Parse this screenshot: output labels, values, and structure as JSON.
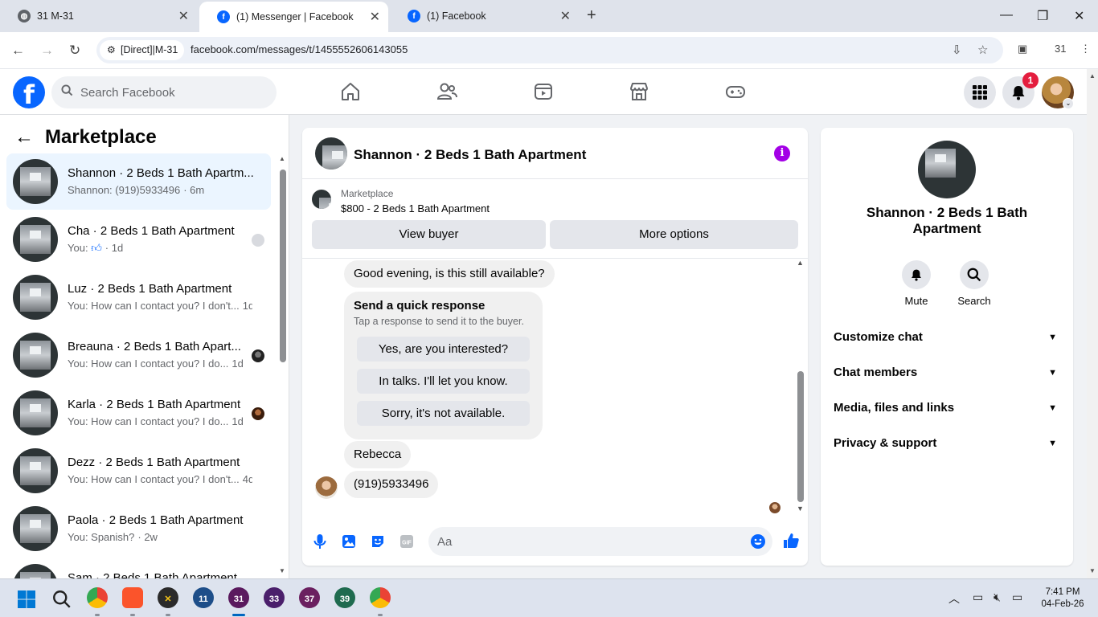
{
  "browser": {
    "tabs": [
      {
        "title": "31 M-31"
      },
      {
        "title": "(1) Messenger | Facebook"
      },
      {
        "title": "(1) Facebook"
      }
    ],
    "site_chip": "[Direct]|M-31",
    "url": "facebook.com/messages/t/1455552606143055",
    "profile_number": "31"
  },
  "fb_header": {
    "search_placeholder": "Search Facebook",
    "notification_count": "1"
  },
  "sidebar": {
    "title": "Marketplace",
    "conversations": [
      {
        "name": "Shannon · 2 Beds 1 Bath Apartm...",
        "preview": "Shannon: (919)5933496",
        "time": "· 6m"
      },
      {
        "name": "Cha · 2 Beds 1 Bath Apartment",
        "preview": "You:",
        "time": "· 1d"
      },
      {
        "name": "Luz · 2 Beds 1 Bath Apartment",
        "preview": "You: How can I contact you? I don't...",
        "time": "1d"
      },
      {
        "name": "Breauna · 2 Beds 1 Bath Apart...",
        "preview": "You: How can I contact you? I do...",
        "time": "1d"
      },
      {
        "name": "Karla · 2 Beds 1 Bath Apartment",
        "preview": "You: How can I contact you? I do...",
        "time": "1d"
      },
      {
        "name": "Dezz · 2 Beds 1 Bath Apartment",
        "preview": "You: How can I contact you? I don't...",
        "time": "4d"
      },
      {
        "name": "Paola · 2 Beds 1 Bath Apartment",
        "preview": "You: Spanish?",
        "time": "· 2w"
      },
      {
        "name": "Sam · 2 Beds 1 Bath Apartment",
        "preview": "",
        "time": ""
      }
    ]
  },
  "chat": {
    "title": "Shannon · 2 Beds 1 Bath Apartment",
    "marketplace_label": "Marketplace",
    "listing": "$800 - 2 Beds 1 Bath Apartment",
    "view_buyer": "View buyer",
    "more_options": "More options",
    "messages": {
      "first": "Good evening, is this still available?",
      "quick_title": "Send a quick response",
      "quick_sub": "Tap a response to send it to the buyer.",
      "quick_replies": [
        "Yes, are you interested?",
        "In talks. I'll let you know.",
        "Sorry, it's not available."
      ],
      "name_msg": "Rebecca",
      "phone_msg": "(919)5933496"
    },
    "composer_placeholder": "Aa"
  },
  "info_panel": {
    "name": "Shannon · 2 Beds 1 Bath Apartment",
    "mute": "Mute",
    "search": "Search",
    "sections": [
      "Customize chat",
      "Chat members",
      "Media, files and links",
      "Privacy & support"
    ]
  },
  "taskbar": {
    "badges": [
      "11",
      "31",
      "33",
      "37",
      "39"
    ],
    "time": "7:41 PM",
    "date": "04-Feb-26"
  },
  "colors": {
    "fb_blue": "#0866ff",
    "active_conv": "#ebf5ff",
    "info_purple": "#a300e6",
    "badge_red": "#e41e3f"
  }
}
